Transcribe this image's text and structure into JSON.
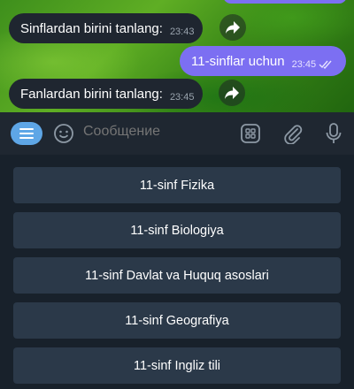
{
  "messages": [
    {
      "direction": "in",
      "text": "Sinflardan birini tanlang:",
      "time": "23:43"
    },
    {
      "direction": "out",
      "text": "11-sinflar uchun",
      "time": "23:45"
    },
    {
      "direction": "in",
      "text": "Fanlardan birini tanlang:",
      "time": "23:45"
    }
  ],
  "composer": {
    "placeholder": "Сообщение"
  },
  "keyboard": {
    "buttons": [
      "11-sinf Fizika",
      "11-sinf Biologiya",
      "11-sinf Davlat va Huquq asoslari",
      "11-sinf Geografiya",
      "11-sinf Ingliz tili"
    ]
  },
  "icons": {
    "forward": "forward-arrow-icon",
    "menu": "menu-icon",
    "emoji": "emoji-icon",
    "bot_keyboard": "bot-keyboard-icon",
    "attach": "paperclip-icon",
    "mic": "microphone-icon",
    "read": "double-check-icon"
  },
  "colors": {
    "outgoing_bubble": "#7c6ff2",
    "incoming_bubble": "#1f2630",
    "keyboard_button": "#2b3949",
    "menu_button": "#5ea6e6"
  }
}
